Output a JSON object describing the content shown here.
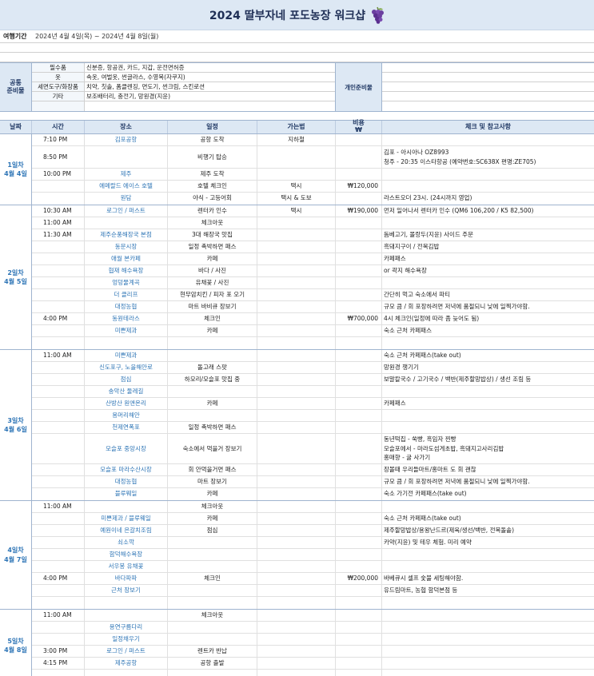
{
  "title": "2024 딸부자네 포도농장 워크샵",
  "icons": {
    "title_icon": "grape-icon"
  },
  "colors": {
    "header_bg": "#dde8f4",
    "day_label": "#2e75b6",
    "place_text": "#2e75b6"
  },
  "period": {
    "label": "여행기간",
    "value": "2024년 4월 4일(목) ~ 2024년 4월 8일(월)"
  },
  "prep": {
    "head_line1": "공통",
    "head_line2": "준비물",
    "rows": [
      {
        "category": "필수품",
        "items": "신분증, 항공권, 카드, 지갑, 운전면허증"
      },
      {
        "category": "옷",
        "items": "속옷, 여벌옷, 썬글라스, 수영복(자쿠지)"
      },
      {
        "category": "세면도구/화장품",
        "items": "치약, 칫솔, 폼클렌징, 면도기, 썬크림, 스킨로션"
      },
      {
        "category": "기타",
        "items": "보조배터리, 충전기, 망원경(지윤)"
      },
      {
        "category": "",
        "items": ""
      }
    ],
    "personal_label": "개인준비물"
  },
  "table_header": {
    "day": "날짜",
    "time": "시간",
    "place": "장소",
    "schedule": "일정",
    "transport": "가는법",
    "cost": "비용",
    "cost_unit": "₩",
    "note": "체크 및 참고사항"
  },
  "days": [
    {
      "label_line1": "1일차",
      "label_line2": "4월 4일",
      "rows": [
        {
          "time": "7:10 PM",
          "place": "김포공항",
          "schedule": "공항 도착",
          "transport": "지하철",
          "cost": "",
          "note": []
        },
        {
          "time": "8:50 PM",
          "place": "",
          "schedule": "비행기 탑승",
          "transport": "",
          "cost": "",
          "note": [
            "김포 - 아시아나 OZ8993",
            "청주 - 20:35 이스타항공 (예약번호:SC638X 편명:ZE705)"
          ],
          "h": 2
        },
        {
          "time": "10:00 PM",
          "place": "제주",
          "schedule": "제주 도착",
          "transport": "",
          "cost": "",
          "note": []
        },
        {
          "time": "",
          "place": "에메랄드 에이스 호텔",
          "schedule": "호텔 체크인",
          "transport": "택시",
          "cost": "₩120,000",
          "note": []
        },
        {
          "time": "",
          "place": "원담",
          "schedule": "야식 - 고등어회",
          "transport": "택시 & 도보",
          "cost": "",
          "note": [
            "라스트오더 23시. (24시까지 영업)"
          ]
        }
      ]
    },
    {
      "label_line1": "2일차",
      "label_line2": "4월 5일",
      "rows": [
        {
          "time": "10:30 AM",
          "place": "로그인 / 퍼스트",
          "schedule": "렌터카 인수",
          "transport": "택시",
          "cost": "₩190,000",
          "note": [
            "먼저 일어나서 렌터카 인수 (QM6 106,200 / K5 82,500)"
          ]
        },
        {
          "time": "11:00 AM",
          "place": "",
          "schedule": "체크아웃",
          "transport": "",
          "cost": "",
          "note": []
        },
        {
          "time": "11:30 AM",
          "place": "제주순풍해장국 본점",
          "schedule": "3대 해장국 맛집",
          "transport": "",
          "cost": "",
          "note": [
            "돔베고기, 몰랑두(지윤) 사이드 주문"
          ]
        },
        {
          "time": "",
          "place": "동문시장",
          "schedule": "일정 촉박하면 패스",
          "transport": "",
          "cost": "",
          "note": [
            "흑돼지구이 / 전복김밥"
          ]
        },
        {
          "time": "",
          "place": "애월 본카페",
          "schedule": "카페",
          "transport": "",
          "cost": "",
          "note": [
            "카페패스"
          ]
        },
        {
          "time": "",
          "place": "협재 해수욕장",
          "schedule": "바다 / 사진",
          "transport": "",
          "cost": "",
          "note": [
            "or 곽지 해수욕장"
          ]
        },
        {
          "time": "",
          "place": "엉덩물계곡",
          "schedule": "유채꽃 / 사진",
          "transport": "",
          "cost": "",
          "note": []
        },
        {
          "time": "",
          "place": "더 클리프",
          "schedule": "현무암치킨 / 피자 포 오기",
          "transport": "",
          "cost": "",
          "note": [
            "간단히 먹고 숙소에서 파티"
          ]
        },
        {
          "time": "",
          "place": "대정농협",
          "schedule": "마트 바비큐 장보기",
          "transport": "",
          "cost": "",
          "note": [
            "규모 큼 / 회 포장하려면 저녁에 품절되니 낮에 일찍가야함."
          ]
        },
        {
          "time": "4:00 PM",
          "place": "동원테라스",
          "schedule": "체크인",
          "transport": "",
          "cost": "₩700,000",
          "note": [
            "4시 체크인(일정에 따라 좀 늦어도 됨)"
          ]
        },
        {
          "time": "",
          "place": "미쁜제과",
          "schedule": "카페",
          "transport": "",
          "cost": "",
          "note": [
            "숙소 근처 카페패스"
          ]
        },
        {
          "time": "",
          "place": "",
          "schedule": "",
          "transport": "",
          "cost": "",
          "note": []
        }
      ]
    },
    {
      "label_line1": "3일차",
      "label_line2": "4월 6일",
      "rows": [
        {
          "time": "11:00 AM",
          "place": "미쁜제과",
          "schedule": "",
          "transport": "",
          "cost": "",
          "note": [
            "숙소 근처 카페패스(take out)"
          ]
        },
        {
          "time": "",
          "place": "신도포구, 노을해안로",
          "schedule": "돌고래 스팟",
          "transport": "",
          "cost": "",
          "note": [
            "망원경 챙기기"
          ]
        },
        {
          "time": "",
          "place": "점심",
          "schedule": "하모리/모슬포 맛집 중",
          "transport": "",
          "cost": "",
          "note": [
            "보말칼국수 / 고기국수 / 백반(제주할망밥상) / 생선 조림 등"
          ]
        },
        {
          "time": "",
          "place": "송악산 둘레길",
          "schedule": "",
          "transport": "",
          "cost": "",
          "note": []
        },
        {
          "time": "",
          "place": "산방산 원앤온리",
          "schedule": "카페",
          "transport": "",
          "cost": "",
          "note": [
            "카페패스"
          ]
        },
        {
          "time": "",
          "place": "용머리해안",
          "schedule": "",
          "transport": "",
          "cost": "",
          "note": []
        },
        {
          "time": "",
          "place": "천제연폭포",
          "schedule": "일정 촉박하면 패스",
          "transport": "",
          "cost": "",
          "note": []
        },
        {
          "time": "",
          "place": "모슬포 중앙시장",
          "schedule": "숙소에서 먹을거 장보기",
          "transport": "",
          "cost": "",
          "note": [
            "동년떡집 - 쑥빵, 흑임자 찐빵",
            "모슬포에서 - 마라도섬게초밥, 흑돼지고사리김밥",
            "홍매향 - 귤 사가기"
          ],
          "h": 3
        },
        {
          "time": "",
          "place": "모슬포 마라수산시장",
          "schedule": "회 안먹을거면 패스",
          "transport": "",
          "cost": "",
          "note": [
            "장볼때 우리들마트/홍마트 도 회 괜찮"
          ]
        },
        {
          "time": "",
          "place": "대정농협",
          "schedule": "마트 장보기",
          "transport": "",
          "cost": "",
          "note": [
            "규모 큼 / 회 포장하려면 저녁에 품절되니 낮에 일찍가야함."
          ]
        },
        {
          "time": "",
          "place": "블루웨일",
          "schedule": "카페",
          "transport": "",
          "cost": "",
          "note": [
            "숙소 가기전 카페패스(take out)"
          ]
        }
      ]
    },
    {
      "label_line1": "4일차",
      "label_line2": "4월 7일",
      "rows": [
        {
          "time": "11:00 AM",
          "place": "",
          "schedule": "체크아웃",
          "transport": "",
          "cost": "",
          "note": []
        },
        {
          "time": "",
          "place": "미쁜제과 / 블루웨일",
          "schedule": "카페",
          "transport": "",
          "cost": "",
          "note": [
            "숙소 근처 카페패스(take out)"
          ]
        },
        {
          "time": "",
          "place": "예원이네 은갈치조림",
          "schedule": "점심",
          "transport": "",
          "cost": "",
          "note": [
            "제주할망밥상/용왕난드르(제육/생선/백반, 전복돌솥)"
          ]
        },
        {
          "time": "",
          "place": "쇠소깍",
          "schedule": "",
          "transport": "",
          "cost": "",
          "note": [
            "카약(지윤) 및 테우 체험. 미리 예약"
          ]
        },
        {
          "time": "",
          "place": "함덕해수욕장",
          "schedule": "",
          "transport": "",
          "cost": "",
          "note": []
        },
        {
          "time": "",
          "place": "서우봉 유채꽃",
          "schedule": "",
          "transport": "",
          "cost": "",
          "note": []
        },
        {
          "time": "4:00 PM",
          "place": "바다파파",
          "schedule": "체크인",
          "transport": "",
          "cost": "₩200,000",
          "note": [
            "바베큐시 셀프 숯불 세팅해야함."
          ]
        },
        {
          "time": "",
          "place": "근처 장보기",
          "schedule": "",
          "transport": "",
          "cost": "",
          "note": [
            "유드림마트, 농협 함덕본점 등"
          ]
        },
        {
          "time": "",
          "place": "",
          "schedule": "",
          "transport": "",
          "cost": "",
          "note": []
        }
      ]
    },
    {
      "label_line1": "5일차",
      "label_line2": "4월 8일",
      "rows": [
        {
          "time": "11:00 AM",
          "place": "",
          "schedule": "체크아웃",
          "transport": "",
          "cost": "",
          "note": []
        },
        {
          "time": "",
          "place": "용연구름다리",
          "schedule": "",
          "transport": "",
          "cost": "",
          "note": []
        },
        {
          "time": "",
          "place": "일정채우기",
          "schedule": "",
          "transport": "",
          "cost": "",
          "note": []
        },
        {
          "time": "3:00 PM",
          "place": "로그인 / 퍼스트",
          "schedule": "렌트카 반납",
          "transport": "",
          "cost": "",
          "note": []
        },
        {
          "time": "4:15 PM",
          "place": "제주공항",
          "schedule": "공항 출발",
          "transport": "",
          "cost": "",
          "note": []
        },
        {
          "time": "",
          "place": "",
          "schedule": "",
          "transport": "",
          "cost": "",
          "note": []
        }
      ]
    }
  ]
}
